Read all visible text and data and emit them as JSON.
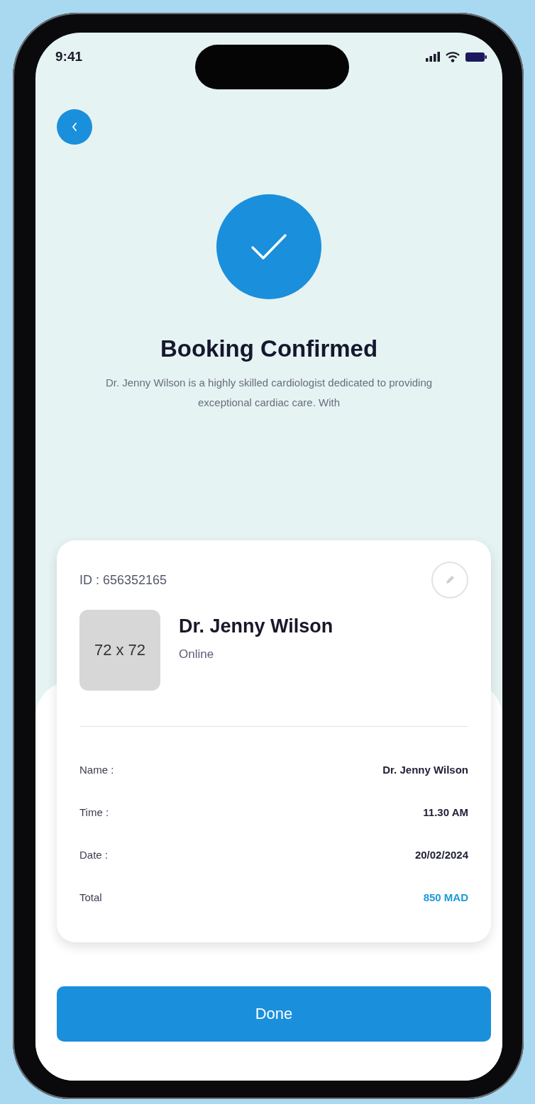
{
  "status_bar": {
    "time": "9:41"
  },
  "header": {
    "title": "Booking Confirmed",
    "description": "Dr. Jenny Wilson is a highly skilled cardiologist dedicated to providing exceptional cardiac care. With"
  },
  "card": {
    "id": "ID : 656352165",
    "avatar_placeholder": "72 x 72",
    "doctor_name": "Dr. Jenny Wilson",
    "mode": "Online",
    "details": [
      {
        "label": "Name :",
        "value": "Dr. Jenny Wilson",
        "kind": "plain"
      },
      {
        "label": "Time :",
        "value": "11.30 AM",
        "kind": "plain"
      },
      {
        "label": "Date :",
        "value": "20/02/2024",
        "kind": "plain"
      },
      {
        "label": "Total",
        "value": "850 MAD",
        "kind": "price"
      }
    ]
  },
  "buttons": [
    "Done"
  ]
}
